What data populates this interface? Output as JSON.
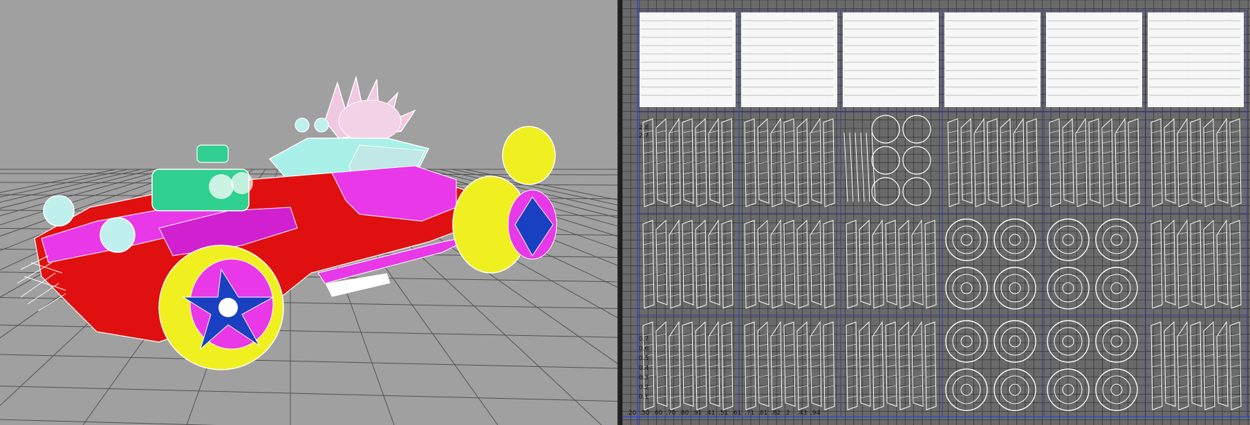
{
  "viewport": {
    "name": "perspective-view",
    "colors": {
      "background": "#a0a0a0",
      "grid": "#505050",
      "body_red": "#e01010",
      "panel_magenta": "#e838e8",
      "wheel_yellow": "#f0f020",
      "glass_cyan": "#a8f0e8",
      "engine_green": "#30d090",
      "rim_blue": "#1840c0",
      "wireframe": "#ffffff"
    }
  },
  "uv_editor": {
    "name": "uv-texture-editor",
    "colors": {
      "background": "#6a6a6a",
      "grid": "#2a2a2a",
      "shell": "#ffffff",
      "border": "#3a3aa0",
      "origin_axis": "#2040ff"
    },
    "v_axis_labels": [
      "2.8",
      "2.7",
      "0.7",
      "0.6",
      "0.5",
      "0.4",
      "0.3",
      "0.2",
      "0.1"
    ],
    "u_axis_labels": [
      ".20",
      ".50",
      ".60",
      ".70",
      ".80",
      ".91",
      ".41",
      ".51",
      ".61",
      ".71",
      ".81",
      ".82",
      ".2",
      ".43",
      ".94"
    ],
    "tile_columns": 6,
    "tile_rows": 4
  }
}
